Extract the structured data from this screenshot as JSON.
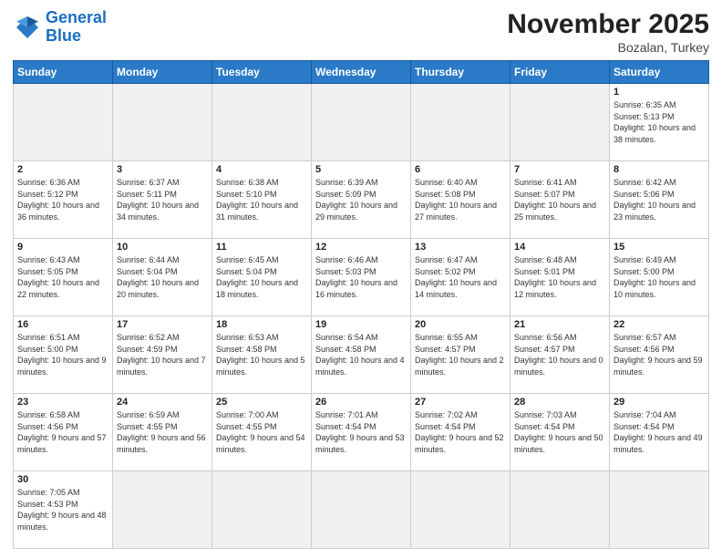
{
  "header": {
    "logo_general": "General",
    "logo_blue": "Blue",
    "title": "November 2025",
    "subtitle": "Bozalan, Turkey"
  },
  "weekdays": [
    "Sunday",
    "Monday",
    "Tuesday",
    "Wednesday",
    "Thursday",
    "Friday",
    "Saturday"
  ],
  "weeks": [
    [
      {
        "day": "",
        "empty": true
      },
      {
        "day": "",
        "empty": true
      },
      {
        "day": "",
        "empty": true
      },
      {
        "day": "",
        "empty": true
      },
      {
        "day": "",
        "empty": true
      },
      {
        "day": "",
        "empty": true
      },
      {
        "day": "1",
        "sunrise": "6:35 AM",
        "sunset": "5:13 PM",
        "daylight": "10 hours and 38 minutes."
      }
    ],
    [
      {
        "day": "2",
        "sunrise": "6:36 AM",
        "sunset": "5:12 PM",
        "daylight": "10 hours and 36 minutes."
      },
      {
        "day": "3",
        "sunrise": "6:37 AM",
        "sunset": "5:11 PM",
        "daylight": "10 hours and 34 minutes."
      },
      {
        "day": "4",
        "sunrise": "6:38 AM",
        "sunset": "5:10 PM",
        "daylight": "10 hours and 31 minutes."
      },
      {
        "day": "5",
        "sunrise": "6:39 AM",
        "sunset": "5:09 PM",
        "daylight": "10 hours and 29 minutes."
      },
      {
        "day": "6",
        "sunrise": "6:40 AM",
        "sunset": "5:08 PM",
        "daylight": "10 hours and 27 minutes."
      },
      {
        "day": "7",
        "sunrise": "6:41 AM",
        "sunset": "5:07 PM",
        "daylight": "10 hours and 25 minutes."
      },
      {
        "day": "8",
        "sunrise": "6:42 AM",
        "sunset": "5:06 PM",
        "daylight": "10 hours and 23 minutes."
      }
    ],
    [
      {
        "day": "9",
        "sunrise": "6:43 AM",
        "sunset": "5:05 PM",
        "daylight": "10 hours and 22 minutes."
      },
      {
        "day": "10",
        "sunrise": "6:44 AM",
        "sunset": "5:04 PM",
        "daylight": "10 hours and 20 minutes."
      },
      {
        "day": "11",
        "sunrise": "6:45 AM",
        "sunset": "5:04 PM",
        "daylight": "10 hours and 18 minutes."
      },
      {
        "day": "12",
        "sunrise": "6:46 AM",
        "sunset": "5:03 PM",
        "daylight": "10 hours and 16 minutes."
      },
      {
        "day": "13",
        "sunrise": "6:47 AM",
        "sunset": "5:02 PM",
        "daylight": "10 hours and 14 minutes."
      },
      {
        "day": "14",
        "sunrise": "6:48 AM",
        "sunset": "5:01 PM",
        "daylight": "10 hours and 12 minutes."
      },
      {
        "day": "15",
        "sunrise": "6:49 AM",
        "sunset": "5:00 PM",
        "daylight": "10 hours and 10 minutes."
      }
    ],
    [
      {
        "day": "16",
        "sunrise": "6:51 AM",
        "sunset": "5:00 PM",
        "daylight": "10 hours and 9 minutes."
      },
      {
        "day": "17",
        "sunrise": "6:52 AM",
        "sunset": "4:59 PM",
        "daylight": "10 hours and 7 minutes."
      },
      {
        "day": "18",
        "sunrise": "6:53 AM",
        "sunset": "4:58 PM",
        "daylight": "10 hours and 5 minutes."
      },
      {
        "day": "19",
        "sunrise": "6:54 AM",
        "sunset": "4:58 PM",
        "daylight": "10 hours and 4 minutes."
      },
      {
        "day": "20",
        "sunrise": "6:55 AM",
        "sunset": "4:57 PM",
        "daylight": "10 hours and 2 minutes."
      },
      {
        "day": "21",
        "sunrise": "6:56 AM",
        "sunset": "4:57 PM",
        "daylight": "10 hours and 0 minutes."
      },
      {
        "day": "22",
        "sunrise": "6:57 AM",
        "sunset": "4:56 PM",
        "daylight": "9 hours and 59 minutes."
      }
    ],
    [
      {
        "day": "23",
        "sunrise": "6:58 AM",
        "sunset": "4:56 PM",
        "daylight": "9 hours and 57 minutes."
      },
      {
        "day": "24",
        "sunrise": "6:59 AM",
        "sunset": "4:55 PM",
        "daylight": "9 hours and 56 minutes."
      },
      {
        "day": "25",
        "sunrise": "7:00 AM",
        "sunset": "4:55 PM",
        "daylight": "9 hours and 54 minutes."
      },
      {
        "day": "26",
        "sunrise": "7:01 AM",
        "sunset": "4:54 PM",
        "daylight": "9 hours and 53 minutes."
      },
      {
        "day": "27",
        "sunrise": "7:02 AM",
        "sunset": "4:54 PM",
        "daylight": "9 hours and 52 minutes."
      },
      {
        "day": "28",
        "sunrise": "7:03 AM",
        "sunset": "4:54 PM",
        "daylight": "9 hours and 50 minutes."
      },
      {
        "day": "29",
        "sunrise": "7:04 AM",
        "sunset": "4:54 PM",
        "daylight": "9 hours and 49 minutes."
      }
    ],
    [
      {
        "day": "30",
        "sunrise": "7:05 AM",
        "sunset": "4:53 PM",
        "daylight": "9 hours and 48 minutes."
      },
      {
        "day": "",
        "empty": true
      },
      {
        "day": "",
        "empty": true
      },
      {
        "day": "",
        "empty": true
      },
      {
        "day": "",
        "empty": true
      },
      {
        "day": "",
        "empty": true
      },
      {
        "day": "",
        "empty": true
      }
    ]
  ],
  "labels": {
    "sunrise": "Sunrise:",
    "sunset": "Sunset:",
    "daylight": "Daylight:"
  }
}
